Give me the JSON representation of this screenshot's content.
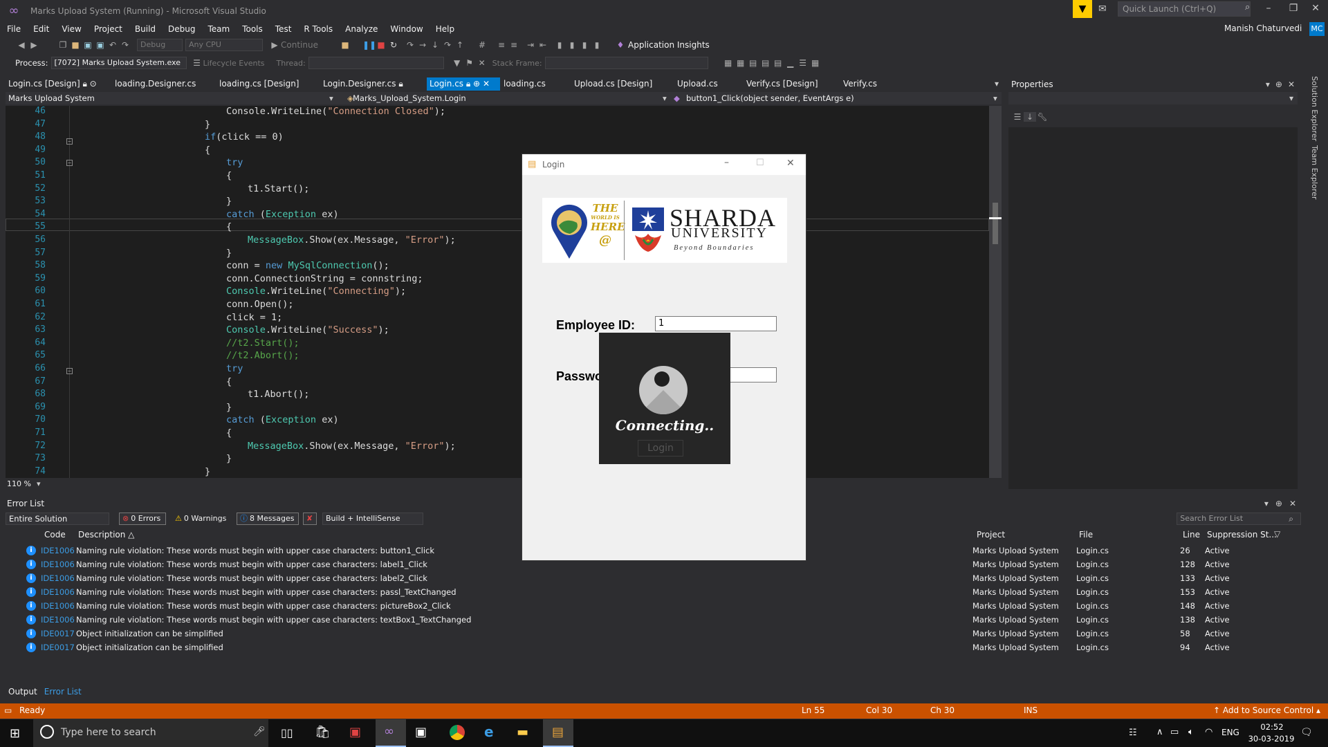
{
  "window": {
    "title": "Marks Upload System (Running) - Microsoft Visual Studio"
  },
  "quick_launch": {
    "placeholder": "Quick Launch (Ctrl+Q)"
  },
  "menu": [
    "File",
    "Edit",
    "View",
    "Project",
    "Build",
    "Debug",
    "Team",
    "Tools",
    "Test",
    "R Tools",
    "Analyze",
    "Window",
    "Help"
  ],
  "user": {
    "name": "Manish Chaturvedi",
    "initials": "MC"
  },
  "toolbar": {
    "config": "Debug",
    "platform": "Any CPU",
    "continue": "Continue",
    "insights": "Application Insights"
  },
  "toolbar2": {
    "process_label": "Process:",
    "process": "[7072] Marks Upload System.exe",
    "lifecycle": "Lifecycle Events",
    "thread_label": "Thread:",
    "stackframe_label": "Stack Frame:"
  },
  "tabs": [
    "Login.cs [Design]",
    "loading.Designer.cs",
    "loading.cs [Design]",
    "Login.Designer.cs",
    "Login.cs",
    "loading.cs",
    "Upload.cs [Design]",
    "Upload.cs",
    "Verify.cs [Design]",
    "Verify.cs"
  ],
  "navbar": {
    "project": "Marks Upload System",
    "class": "Marks_Upload_System.Login",
    "member": "button1_Click(object sender, EventArgs e)"
  },
  "code_lines": [
    "46",
    "47",
    "48",
    "49",
    "50",
    "51",
    "52",
    "53",
    "54",
    "55",
    "56",
    "57",
    "58",
    "59",
    "60",
    "61",
    "62",
    "63",
    "64",
    "65",
    "66",
    "67",
    "68",
    "69",
    "70",
    "71",
    "72",
    "73",
    "74"
  ],
  "zoom": "110 %",
  "properties": {
    "title": "Properties"
  },
  "side_tabs": [
    "Solution Explorer",
    "Team Explorer"
  ],
  "error_list": {
    "title": "Error List",
    "scope": "Entire Solution",
    "errors": "0 Errors",
    "warnings": "0 Warnings",
    "messages": "8 Messages",
    "build": "Build + IntelliSense",
    "search": "Search Error List",
    "headers": {
      "code": "Code",
      "description": "Description",
      "project": "Project",
      "file": "File",
      "line": "Line",
      "suppression": "Suppression St..."
    },
    "rows": [
      {
        "code": "IDE1006",
        "desc": "Naming rule violation: These words must begin with upper case characters: button1_Click",
        "project": "Marks Upload System",
        "file": "Login.cs",
        "line": "26",
        "state": "Active"
      },
      {
        "code": "IDE1006",
        "desc": "Naming rule violation: These words must begin with upper case characters: label1_Click",
        "project": "Marks Upload System",
        "file": "Login.cs",
        "line": "128",
        "state": "Active"
      },
      {
        "code": "IDE1006",
        "desc": "Naming rule violation: These words must begin with upper case characters: label2_Click",
        "project": "Marks Upload System",
        "file": "Login.cs",
        "line": "133",
        "state": "Active"
      },
      {
        "code": "IDE1006",
        "desc": "Naming rule violation: These words must begin with upper case characters: passl_TextChanged",
        "project": "Marks Upload System",
        "file": "Login.cs",
        "line": "153",
        "state": "Active"
      },
      {
        "code": "IDE1006",
        "desc": "Naming rule violation: These words must begin with upper case characters: pictureBox2_Click",
        "project": "Marks Upload System",
        "file": "Login.cs",
        "line": "148",
        "state": "Active"
      },
      {
        "code": "IDE1006",
        "desc": "Naming rule violation: These words must begin with upper case characters: textBox1_TextChanged",
        "project": "Marks Upload System",
        "file": "Login.cs",
        "line": "138",
        "state": "Active"
      },
      {
        "code": "IDE0017",
        "desc": "Object initialization can be simplified",
        "project": "Marks Upload System",
        "file": "Login.cs",
        "line": "58",
        "state": "Active"
      },
      {
        "code": "IDE0017",
        "desc": "Object initialization can be simplified",
        "project": "Marks Upload System",
        "file": "Login.cs",
        "line": "94",
        "state": "Active"
      }
    ]
  },
  "bottom_tabs": {
    "output": "Output",
    "errorlist": "Error List"
  },
  "status": {
    "ready": "Ready",
    "ln": "Ln 55",
    "col": "Col 30",
    "ch": "Ch 30",
    "ins": "INS",
    "source_control": "Add to Source Control"
  },
  "taskbar": {
    "search": "Type here to search",
    "lang": "ENG",
    "time": "02:52",
    "date": "30-03-2019"
  },
  "login": {
    "title": "Login",
    "logo_text1": "THE",
    "logo_text2": "WORLD IS",
    "logo_text3": "HERE",
    "logo_text4": "@",
    "brand": "SHARDA",
    "brand2": "UNIVERSITY",
    "tagline": "Beyond Boundaries",
    "emp_label": "Employee ID:",
    "emp_value": "1",
    "pw_label": "Password:",
    "connecting": "Connecting..",
    "login_button": "Login"
  },
  "colors": {
    "accent": "#007acc",
    "status": "#ca5100",
    "keyword": "#569cd6",
    "string": "#d69d85",
    "type": "#4ec9b0",
    "comment": "#57a64a"
  }
}
